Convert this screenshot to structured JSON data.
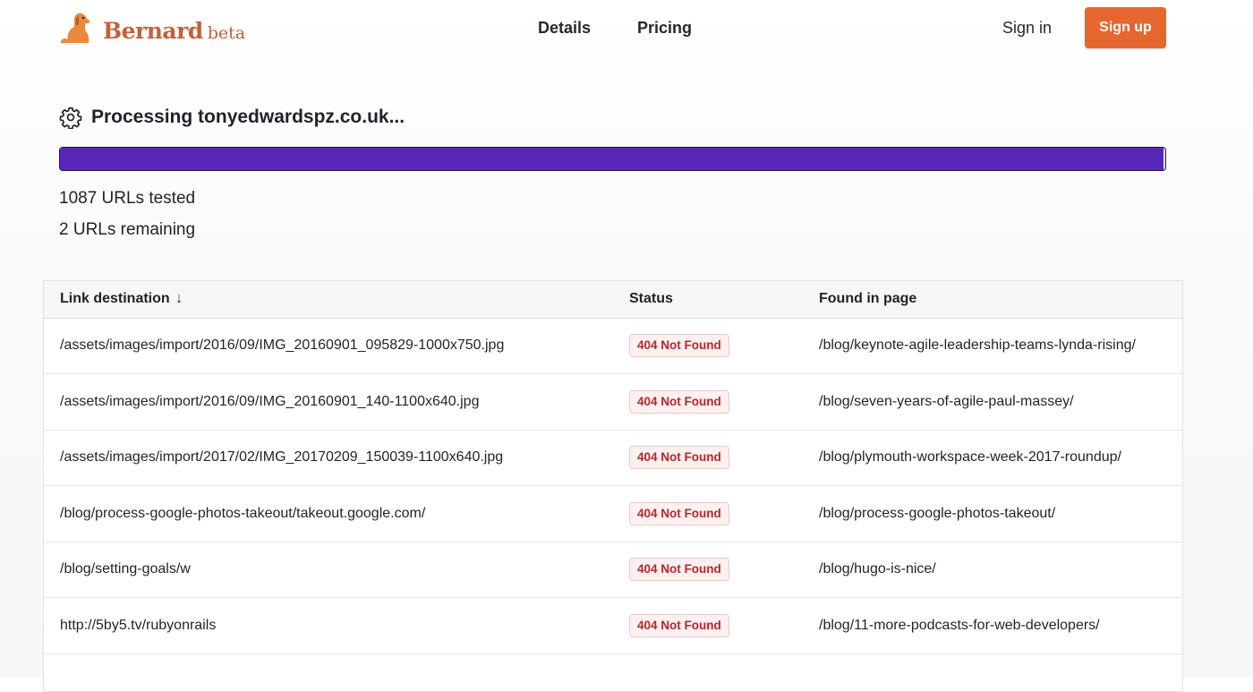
{
  "brand": {
    "name": "Bernard",
    "tag": "beta"
  },
  "nav": {
    "details": "Details",
    "pricing": "Pricing",
    "sign_in": "Sign in",
    "sign_up": "Sign up"
  },
  "processing": {
    "title": "Processing tonyedwardspz.co.uk...",
    "progress_fraction": 0.998
  },
  "stats": {
    "tested": "1087 URLs tested",
    "remaining": "2 URLs remaining"
  },
  "colors": {
    "accent": "#e5662f",
    "brand": "#c4603a",
    "progress": "#5626b8",
    "badge_text": "#b8262c"
  },
  "table": {
    "headers": {
      "link": "Link destination",
      "sort_arrow": "↓",
      "status": "Status",
      "found": "Found in page"
    },
    "rows": [
      {
        "link": "/assets/images/import/2016/09/IMG_20160901_095829-1000x750.jpg",
        "status": "404 Not Found",
        "found": "/blog/keynote-agile-leadership-teams-lynda-rising/"
      },
      {
        "link": "/assets/images/import/2016/09/IMG_20160901_140-1100x640.jpg",
        "status": "404 Not Found",
        "found": "/blog/seven-years-of-agile-paul-massey/"
      },
      {
        "link": "/assets/images/import/2017/02/IMG_20170209_150039-1100x640.jpg",
        "status": "404 Not Found",
        "found": "/blog/plymouth-workspace-week-2017-roundup/"
      },
      {
        "link": "/blog/process-google-photos-takeout/takeout.google.com/",
        "status": "404 Not Found",
        "found": "/blog/process-google-photos-takeout/"
      },
      {
        "link": "/blog/setting-goals/w",
        "status": "404 Not Found",
        "found": "/blog/hugo-is-nice/"
      },
      {
        "link": "http://5by5.tv/rubyonrails",
        "status": "404 Not Found",
        "found": "/blog/11-more-podcasts-for-web-developers/"
      }
    ]
  }
}
